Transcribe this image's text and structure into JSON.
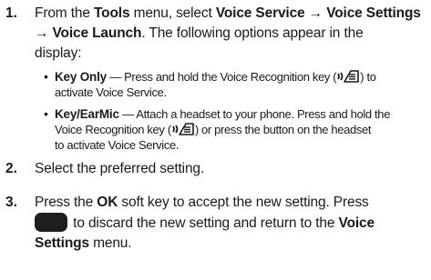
{
  "steps": [
    {
      "number": "1.",
      "line1_pre": "From the ",
      "line1_tools": "Tools",
      "line1_mid": " menu, select ",
      "line1_path": "Voice Service → Voice Settings",
      "line2_path": "→ Voice Launch",
      "line2_post": ". The following options appear in the",
      "line3": "display:",
      "bullets": [
        {
          "title": "Key Only",
          "text_a": " — Press and hold the Voice Recognition key (",
          "text_b": ") to",
          "text_c": "activate Voice Service.",
          "key_icon": "voice-recognition-key-icon"
        },
        {
          "title": "Key/EarMic",
          "text_a": " — Attach a headset to your phone. Press and hold the",
          "text_b": "Voice Recognition key (",
          "text_c": ") or press the button on the headset",
          "text_d": "to activate Voice Service.",
          "key_icon": "voice-recognition-key-icon"
        }
      ]
    },
    {
      "number": "2.",
      "text": "Select the preferred setting."
    },
    {
      "number": "3.",
      "line1_pre": "Press the ",
      "line1_ok": "OK",
      "line1_post": " soft key to accept the new setting. Press",
      "line2": " to discard the new setting and return to the ",
      "line2_voice": "Voice",
      "line3_settings": "Settings",
      "line3_post": " menu.",
      "key_icon": "end-key-icon"
    }
  ],
  "colors": {
    "text": "#1a1a1a",
    "key_fill": "#1e1e1e"
  }
}
